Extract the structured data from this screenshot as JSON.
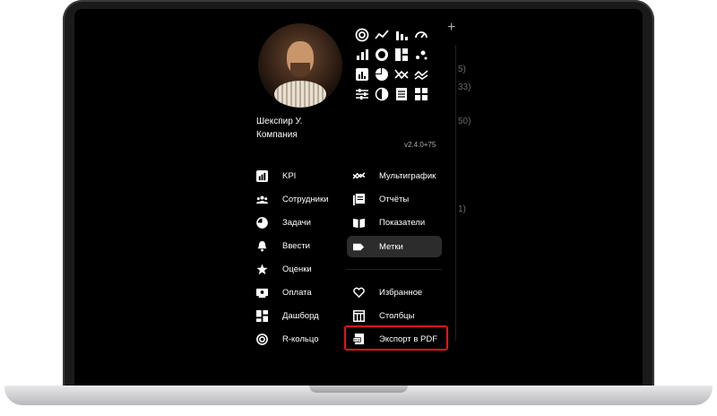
{
  "profile": {
    "name": "Шекспир У.",
    "company": "Компания",
    "version": "v2.4.0+75"
  },
  "icon_grid": [
    "radial-ring-icon",
    "line-chart-icon",
    "bar-chart-icon",
    "gauge-icon",
    "bar-chart-ascending-icon",
    "donut-icon",
    "dashboard-tiles-icon",
    "scatter-icon",
    "bar-chart-box-icon",
    "pie-chart-icon",
    "crossed-lines-icon",
    "multi-line-icon",
    "sliders-icon",
    "pie-half-icon",
    "report-icon",
    "grid-tiles-icon"
  ],
  "menu_left": [
    {
      "label": "KPI",
      "icon": "kpi-icon"
    },
    {
      "label": "Сотрудники",
      "icon": "people-icon"
    },
    {
      "label": "Задачи",
      "icon": "tasks-icon"
    },
    {
      "label": "Ввести",
      "icon": "bell-icon"
    },
    {
      "label": "Оценки",
      "icon": "star-icon"
    },
    {
      "label": "Оплата",
      "icon": "payment-icon"
    },
    {
      "label": "Дашборд",
      "icon": "dashboard-icon"
    },
    {
      "label": "R-кольцо",
      "icon": "ring-icon"
    }
  ],
  "menu_right": [
    {
      "label": "Мультиграфик",
      "icon": "multichart-icon"
    },
    {
      "label": "Отчёты",
      "icon": "reports-icon"
    },
    {
      "label": "Показатели",
      "icon": "book-icon"
    },
    {
      "label": "Метки",
      "icon": "tag-icon",
      "active": true
    },
    {
      "label": "Избранное",
      "icon": "heart-icon"
    },
    {
      "label": "Столбцы",
      "icon": "columns-icon"
    },
    {
      "label": "Экспорт в PDF",
      "icon": "pdf-icon",
      "highlighted": true
    }
  ],
  "background_fragments": [
    "5)",
    "33)",
    "50)",
    "1)"
  ]
}
